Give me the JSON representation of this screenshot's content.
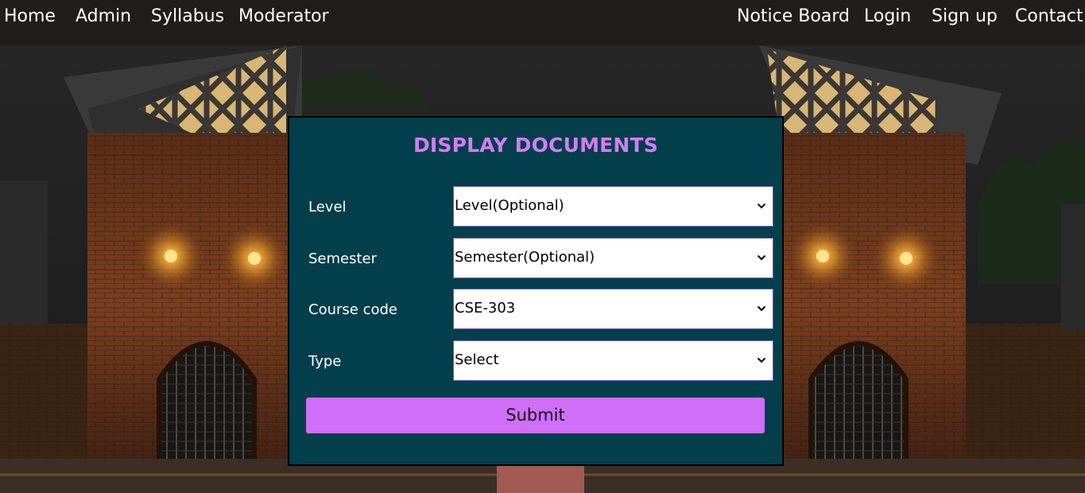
{
  "nav": {
    "left": [
      "Home",
      "Admin",
      "Syllabus",
      "Moderator"
    ],
    "right": [
      "Notice Board",
      "Login",
      "Sign up",
      "Contact"
    ]
  },
  "form": {
    "title": "DISPLAY DOCUMENTS",
    "fields": [
      {
        "label": "Level",
        "value": "Level(Optional)"
      },
      {
        "label": "Semester",
        "value": "Semester(Optional)"
      },
      {
        "label": "Course code",
        "value": "CSE-303"
      },
      {
        "label": "Type",
        "value": "Select"
      }
    ],
    "submit_label": "Submit"
  },
  "colors": {
    "panel_bg": "#033f4b",
    "title": "#d57cf3",
    "submit_bg": "#cf6ef7",
    "navbar_bg": "#201e1d"
  }
}
